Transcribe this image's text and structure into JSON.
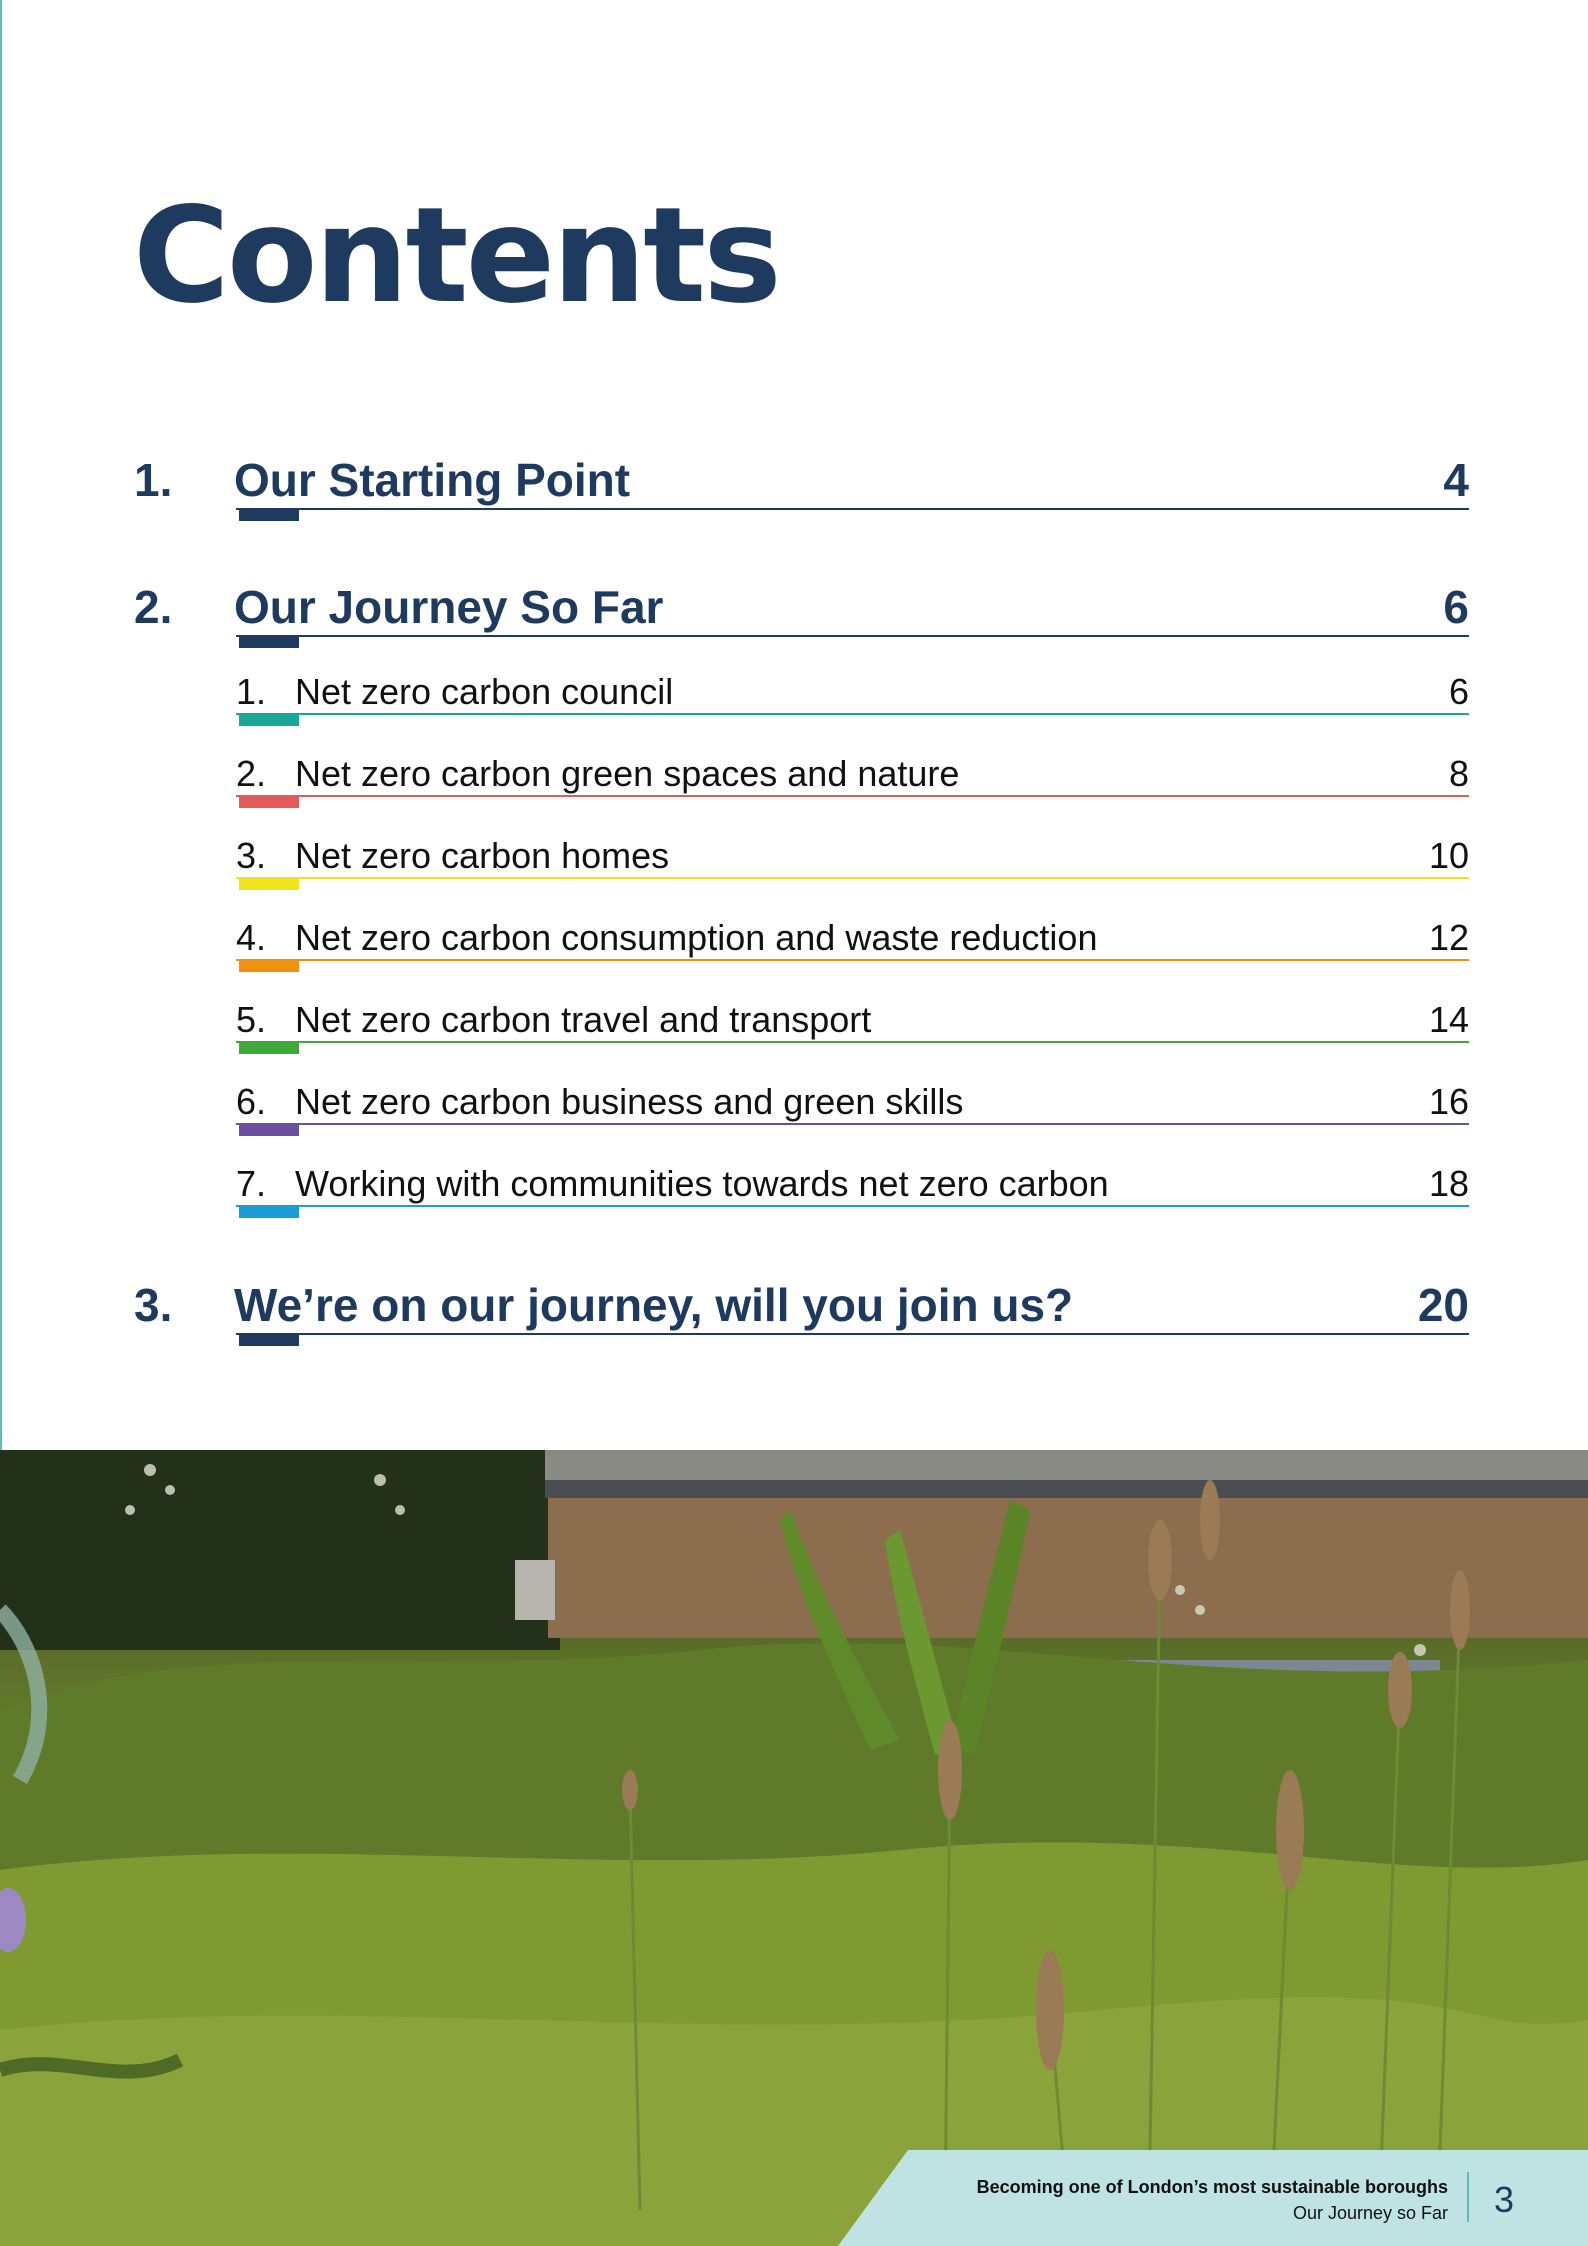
{
  "heading": "Contents",
  "toc": {
    "main": [
      {
        "num": "1.",
        "label": "Our Starting Point",
        "page": "4"
      },
      {
        "num": "2.",
        "label": "Our Journey So Far",
        "page": "6"
      },
      {
        "num": "3.",
        "label": "We’re on our journey, will you join us?",
        "page": "20"
      }
    ],
    "sub": [
      {
        "num": "1.",
        "label": "Net zero carbon council",
        "page": "6",
        "color": "#1aa79a"
      },
      {
        "num": "2.",
        "label": "Net zero carbon green spaces and nature",
        "page": "8",
        "color": "#e4595a"
      },
      {
        "num": "3.",
        "label": "Net zero carbon homes",
        "page": "10",
        "color": "#f2e21b"
      },
      {
        "num": "4.",
        "label": "Net zero carbon consumption and waste reduction",
        "page": "12",
        "color": "#f0920e"
      },
      {
        "num": "5.",
        "label": "Net zero carbon travel and transport",
        "page": "14",
        "color": "#3ea83a"
      },
      {
        "num": "6.",
        "label": "Net zero carbon business and green skills",
        "page": "16",
        "color": "#6b4fa0"
      },
      {
        "num": "7.",
        "label": "Working with communities towards net zero carbon",
        "page": "18",
        "color": "#1b9ed8"
      }
    ],
    "main_color": "#1e3a5f"
  },
  "footer": {
    "title": "Becoming one of London’s most sustainable boroughs",
    "subtitle": "Our Journey so Far",
    "page": "3"
  },
  "photo": {
    "icon": "green-roof-meadow-photo"
  }
}
